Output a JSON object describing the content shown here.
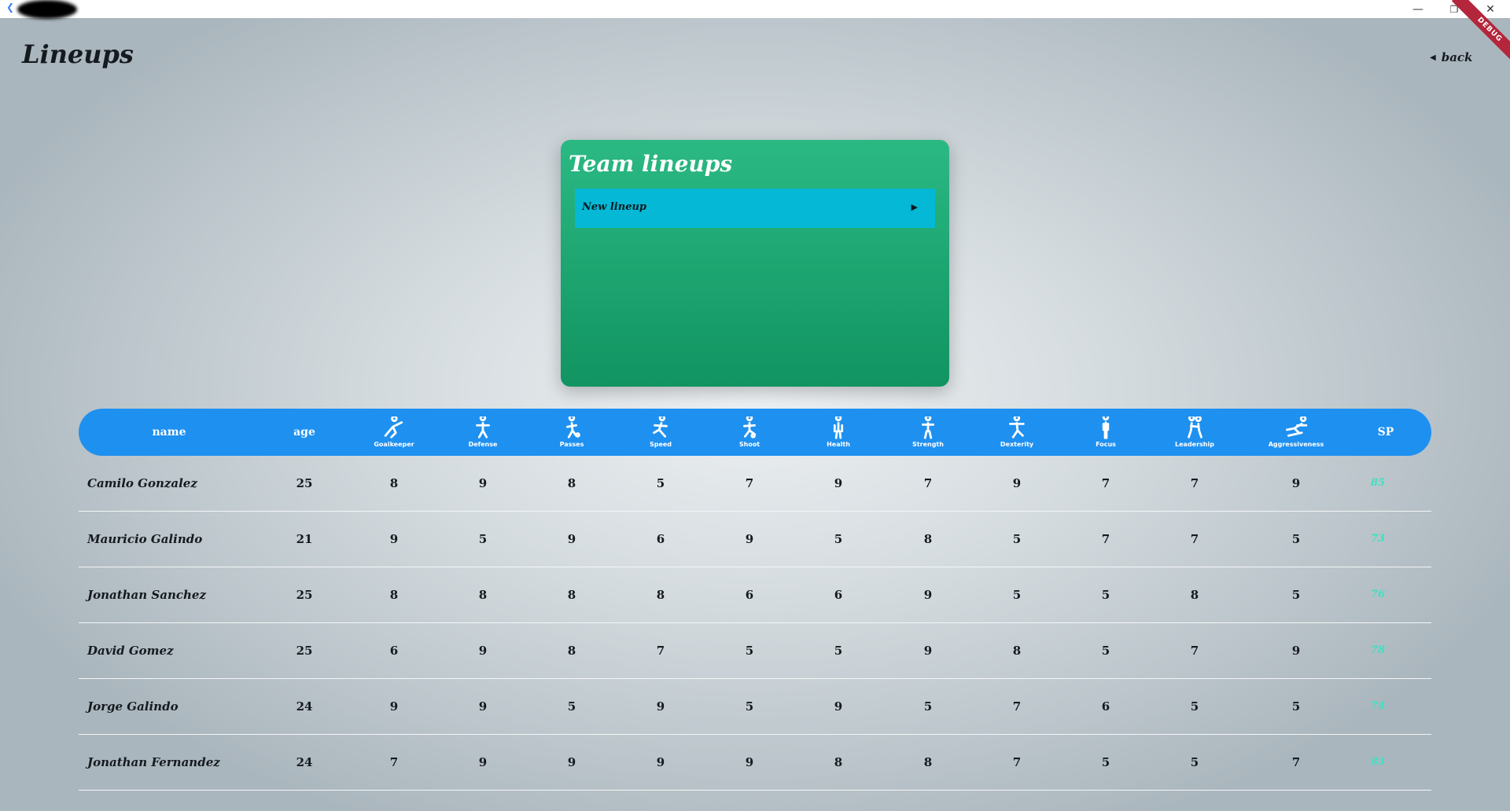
{
  "window": {
    "minimize_glyph": "—",
    "maximize_glyph": "❐",
    "close_glyph": "✕",
    "debug_banner": "DEBUG"
  },
  "page": {
    "title": "Lineups",
    "back_label": "back"
  },
  "card": {
    "title": "Team lineups",
    "items": [
      {
        "label": "New lineup"
      }
    ]
  },
  "table": {
    "header": {
      "name": "name",
      "age": "age",
      "stats": [
        "Goalkeeper",
        "Defense",
        "Passes",
        "Speed",
        "Shoot",
        "Health",
        "Strength",
        "Dexterity",
        "Focus",
        "Leadership",
        "Aggressiveness"
      ],
      "sp": "SP"
    },
    "rows": [
      {
        "name": "Camilo Gonzalez",
        "age": "25",
        "stats": [
          "8",
          "9",
          "8",
          "5",
          "7",
          "9",
          "7",
          "9",
          "7",
          "7",
          "9"
        ],
        "sp": "85"
      },
      {
        "name": "Mauricio Galindo",
        "age": "21",
        "stats": [
          "9",
          "5",
          "9",
          "6",
          "9",
          "5",
          "8",
          "5",
          "7",
          "7",
          "5"
        ],
        "sp": "73"
      },
      {
        "name": "Jonathan Sanchez",
        "age": "25",
        "stats": [
          "8",
          "8",
          "8",
          "8",
          "6",
          "6",
          "9",
          "5",
          "5",
          "8",
          "5"
        ],
        "sp": "76"
      },
      {
        "name": "David Gomez",
        "age": "25",
        "stats": [
          "6",
          "9",
          "8",
          "7",
          "5",
          "5",
          "9",
          "8",
          "5",
          "7",
          "9"
        ],
        "sp": "78"
      },
      {
        "name": "Jorge Galindo",
        "age": "24",
        "stats": [
          "9",
          "9",
          "5",
          "9",
          "5",
          "9",
          "5",
          "7",
          "6",
          "5",
          "5"
        ],
        "sp": "74"
      },
      {
        "name": "Jonathan Fernandez",
        "age": "24",
        "stats": [
          "7",
          "9",
          "9",
          "9",
          "9",
          "8",
          "8",
          "7",
          "5",
          "5",
          "7"
        ],
        "sp": "83"
      }
    ]
  },
  "colors": {
    "header_bar": "#1e90f0",
    "card_top": "#2bb983",
    "card_bottom": "#119461",
    "lineup_item": "#04b8d6",
    "sp_text": "#3fe0c3"
  },
  "icons": {
    "stats": [
      "goalkeeper-icon",
      "defense-icon",
      "passes-icon",
      "speed-icon",
      "shoot-icon",
      "health-icon",
      "strength-icon",
      "dexterity-icon",
      "focus-icon",
      "leadership-icon",
      "aggressiveness-icon"
    ]
  }
}
